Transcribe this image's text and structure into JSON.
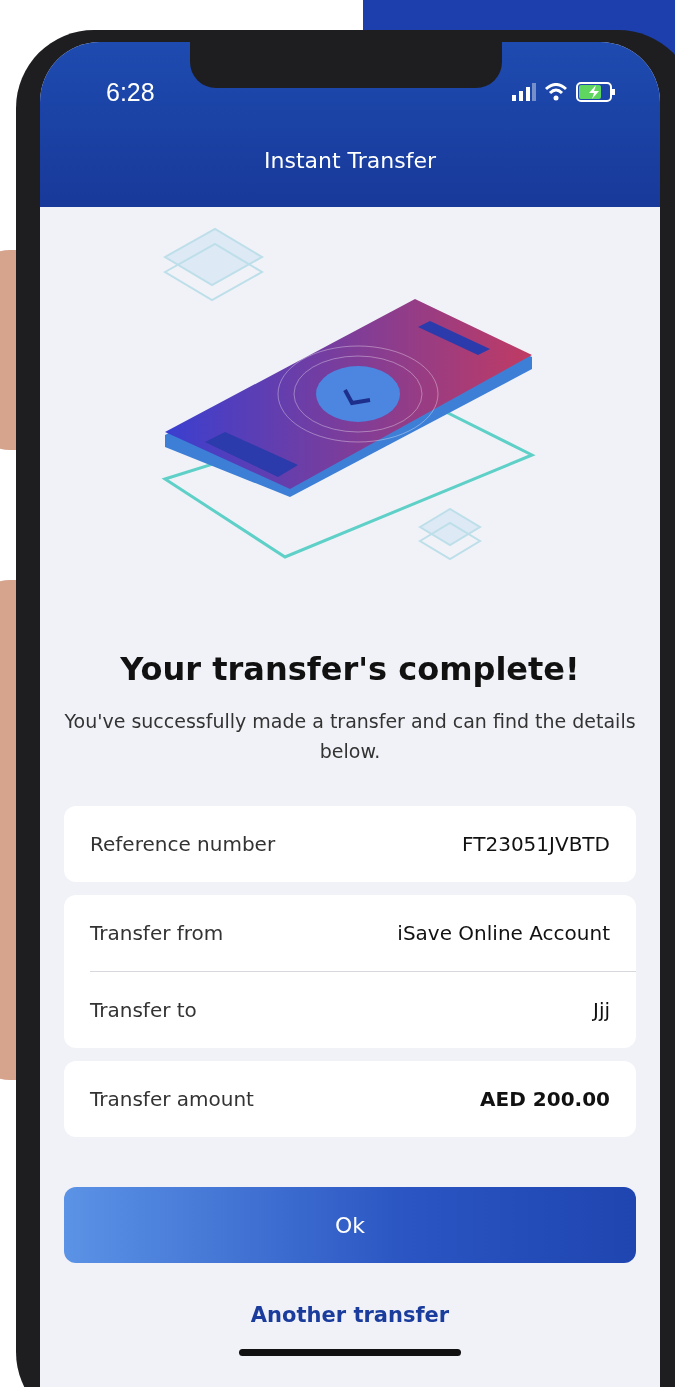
{
  "status_bar": {
    "time": "6:28"
  },
  "header": {
    "title": "Instant Transfer"
  },
  "result": {
    "heading": "Your transfer's complete!",
    "message": "You've successfully made a transfer and can find the details below."
  },
  "detail_groups": [
    {
      "rows": [
        {
          "label": "Reference number",
          "value": "FT23051JVBTD",
          "emphasis": false
        }
      ]
    },
    {
      "rows": [
        {
          "label": "Transfer from",
          "value": "iSave Online Account",
          "emphasis": false
        },
        {
          "label": "Transfer to",
          "value": "Jjj",
          "emphasis": false
        }
      ]
    },
    {
      "rows": [
        {
          "label": "Transfer amount",
          "value": "AED 200.00",
          "emphasis": true
        }
      ]
    }
  ],
  "primary_button": {
    "label": "Ok"
  },
  "secondary_link": {
    "label": "Another transfer"
  }
}
